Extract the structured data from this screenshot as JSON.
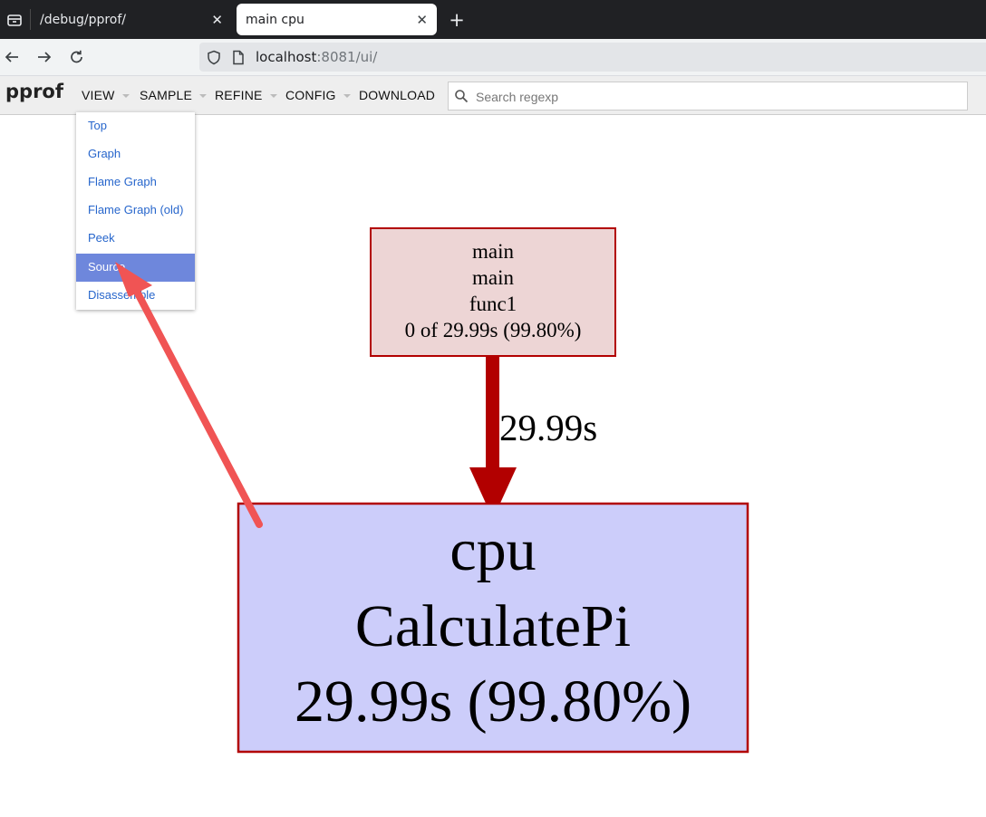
{
  "browser": {
    "tabs": [
      {
        "title": "/debug/pprof/",
        "active": false
      },
      {
        "title": "main cpu",
        "active": true
      }
    ],
    "close_glyph": "✕",
    "new_tab_glyph": "+",
    "url": {
      "host": "localhost",
      "rest": ":8081/ui/"
    }
  },
  "pprof": {
    "title": "pprof",
    "menu": [
      {
        "label": "VIEW",
        "has_caret": true
      },
      {
        "label": "SAMPLE",
        "has_caret": true
      },
      {
        "label": "REFINE",
        "has_caret": true
      },
      {
        "label": "CONFIG",
        "has_caret": true
      },
      {
        "label": "DOWNLOAD",
        "has_caret": false
      }
    ],
    "search": {
      "placeholder": "Search regexp",
      "value": ""
    },
    "view_dropdown": {
      "items": [
        "Top",
        "Graph",
        "Flame Graph",
        "Flame Graph (old)",
        "Peek",
        "Source",
        "Disassemble"
      ],
      "selected": "Source"
    }
  },
  "graph": {
    "nodes": [
      {
        "id": "main-node",
        "lines": [
          "main",
          "main",
          "func1",
          "0 of 29.99s (99.80%)"
        ],
        "fill": "#edd5d5",
        "stroke": "#b20000"
      },
      {
        "id": "cpu-node",
        "lines": [
          "cpu",
          "CalculatePi",
          "29.99s (99.80%)"
        ],
        "fill": "#cccdfa",
        "stroke": "#b20000"
      }
    ],
    "edge": {
      "label": "29.99s",
      "color": "#b20000"
    }
  },
  "annotation": {
    "arrow_color": "#f05454"
  },
  "icons": [
    "tab-overview-icon",
    "back-arrow-icon",
    "forward-arrow-icon",
    "reload-icon",
    "shield-icon",
    "page-icon",
    "search-icon"
  ]
}
